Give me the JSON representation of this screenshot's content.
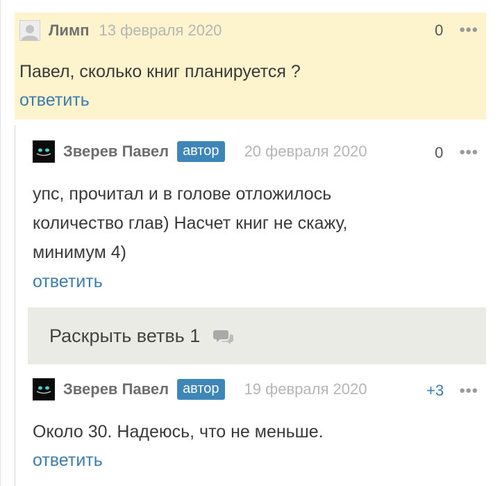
{
  "comments": [
    {
      "author": "Лимп",
      "badge": "",
      "date": "13 февраля 2020",
      "score": "0",
      "more_icon": "more-dots-icon",
      "text": [
        "Павел, сколько книг планируется ?"
      ],
      "reply_label": "ответить",
      "avatar_icon": "default-avatar-icon",
      "highlight_color": "#fdf3cd"
    },
    {
      "author": "Зверев Павел",
      "badge": "автор",
      "date": "20 февраля 2020",
      "score": "0",
      "more_icon": "more-dots-icon",
      "text": [
        "упс, прочитал и в голове отложилось",
        "количество глав) Насчет книг не скажу,",
        "минимум 4)"
      ],
      "reply_label": "ответить",
      "avatar_icon": "cat-eyes-avatar-icon"
    },
    {
      "author": "Зверев Павел",
      "badge": "автор",
      "date": "19 февраля 2020",
      "score": "+3",
      "more_icon": "more-dots-icon",
      "text": [
        "Около 30. Надеюсь, что не меньше."
      ],
      "reply_label": "ответить",
      "avatar_icon": "cat-eyes-avatar-icon"
    }
  ],
  "expand_thread": {
    "label": "Раскрыть ветвь 1",
    "icon": "chat-bubbles-icon"
  },
  "colors": {
    "link": "#3d7dad",
    "badge_bg": "#3f86b8",
    "expand_bg": "#ebebe5"
  }
}
